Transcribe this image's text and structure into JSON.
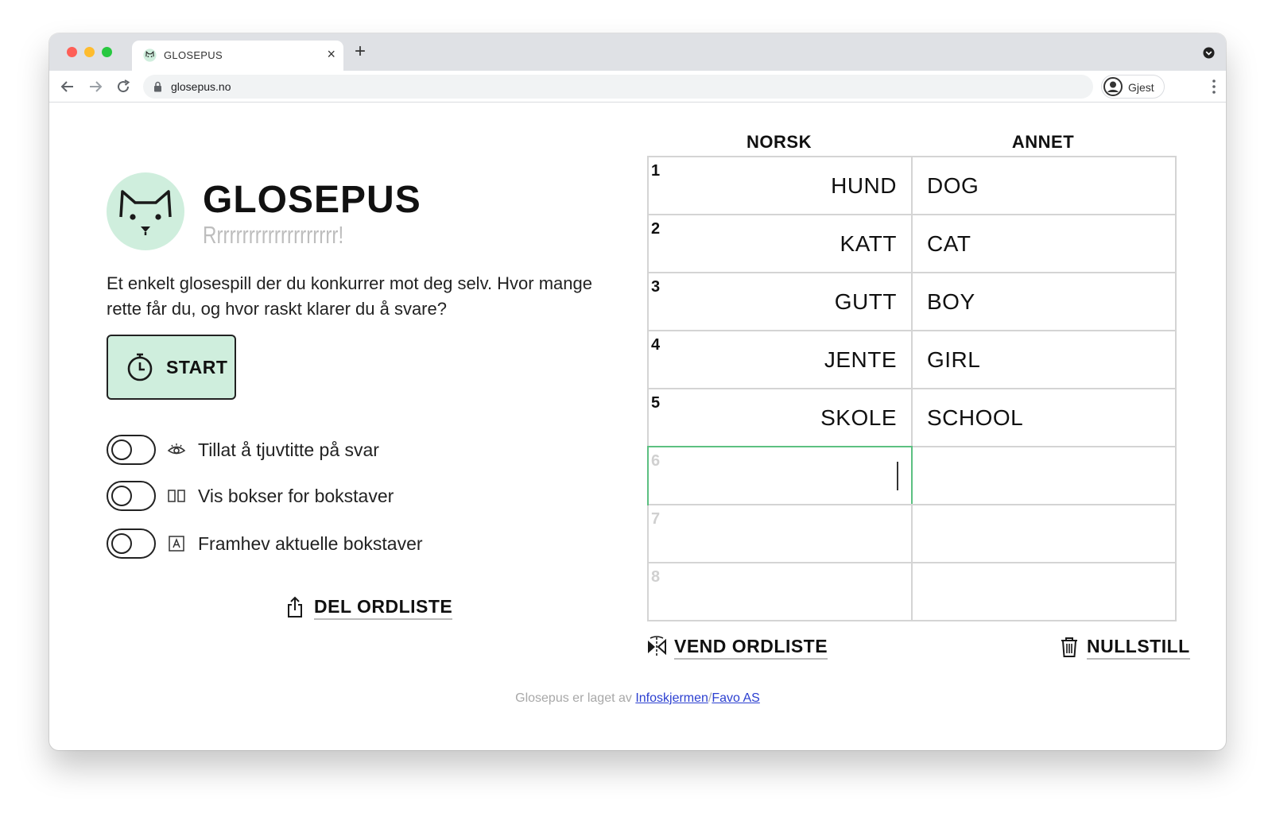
{
  "browser": {
    "tab_title": "GLOSEPUS",
    "tab_close": "×",
    "new_tab": "+",
    "url": "glosepus.no",
    "profile_label": "Gjest"
  },
  "app": {
    "title": "GLOSEPUS",
    "tagline": "Rrrrrrrrrrrrrrrrrrrr!",
    "description": "Et enkelt glosespill der du konkurrer mot deg selv. Hvor mange rette får du, og hvor raskt klarer du å svare?",
    "start_label": "START"
  },
  "options": [
    {
      "label": "Tillat å tjuvtitte på svar",
      "icon": "eye-icon",
      "enabled": false
    },
    {
      "label": "Vis bokser for bokstaver",
      "icon": "letter-boxes-icon",
      "enabled": false
    },
    {
      "label": "Framhev aktuelle bokstaver",
      "icon": "highlight-letter-icon",
      "enabled": false
    }
  ],
  "share_label": "DEL ORDLISTE",
  "table": {
    "headers": {
      "norsk": "NORSK",
      "annet": "ANNET"
    },
    "rows": [
      {
        "num": "1",
        "norsk": "HUND",
        "annet": "DOG"
      },
      {
        "num": "2",
        "norsk": "KATT",
        "annet": "CAT"
      },
      {
        "num": "3",
        "norsk": "GUTT",
        "annet": "BOY"
      },
      {
        "num": "4",
        "norsk": "JENTE",
        "annet": "GIRL"
      },
      {
        "num": "5",
        "norsk": "SKOLE",
        "annet": "SCHOOL"
      },
      {
        "num": "6",
        "norsk": "",
        "annet": ""
      },
      {
        "num": "7",
        "norsk": "",
        "annet": ""
      },
      {
        "num": "8",
        "norsk": "",
        "annet": ""
      }
    ],
    "active_row": 6
  },
  "actions": {
    "flip_label": "VEND ORDLISTE",
    "reset_label": "NULLSTILL"
  },
  "footer": {
    "text": "Glosepus er laget av",
    "link1": "Infoskjermen",
    "separator": "/",
    "link2": "Favo AS"
  },
  "colors": {
    "accent": "#cfeedd",
    "active_border": "#5cc081",
    "link": "#2b3fd0"
  }
}
